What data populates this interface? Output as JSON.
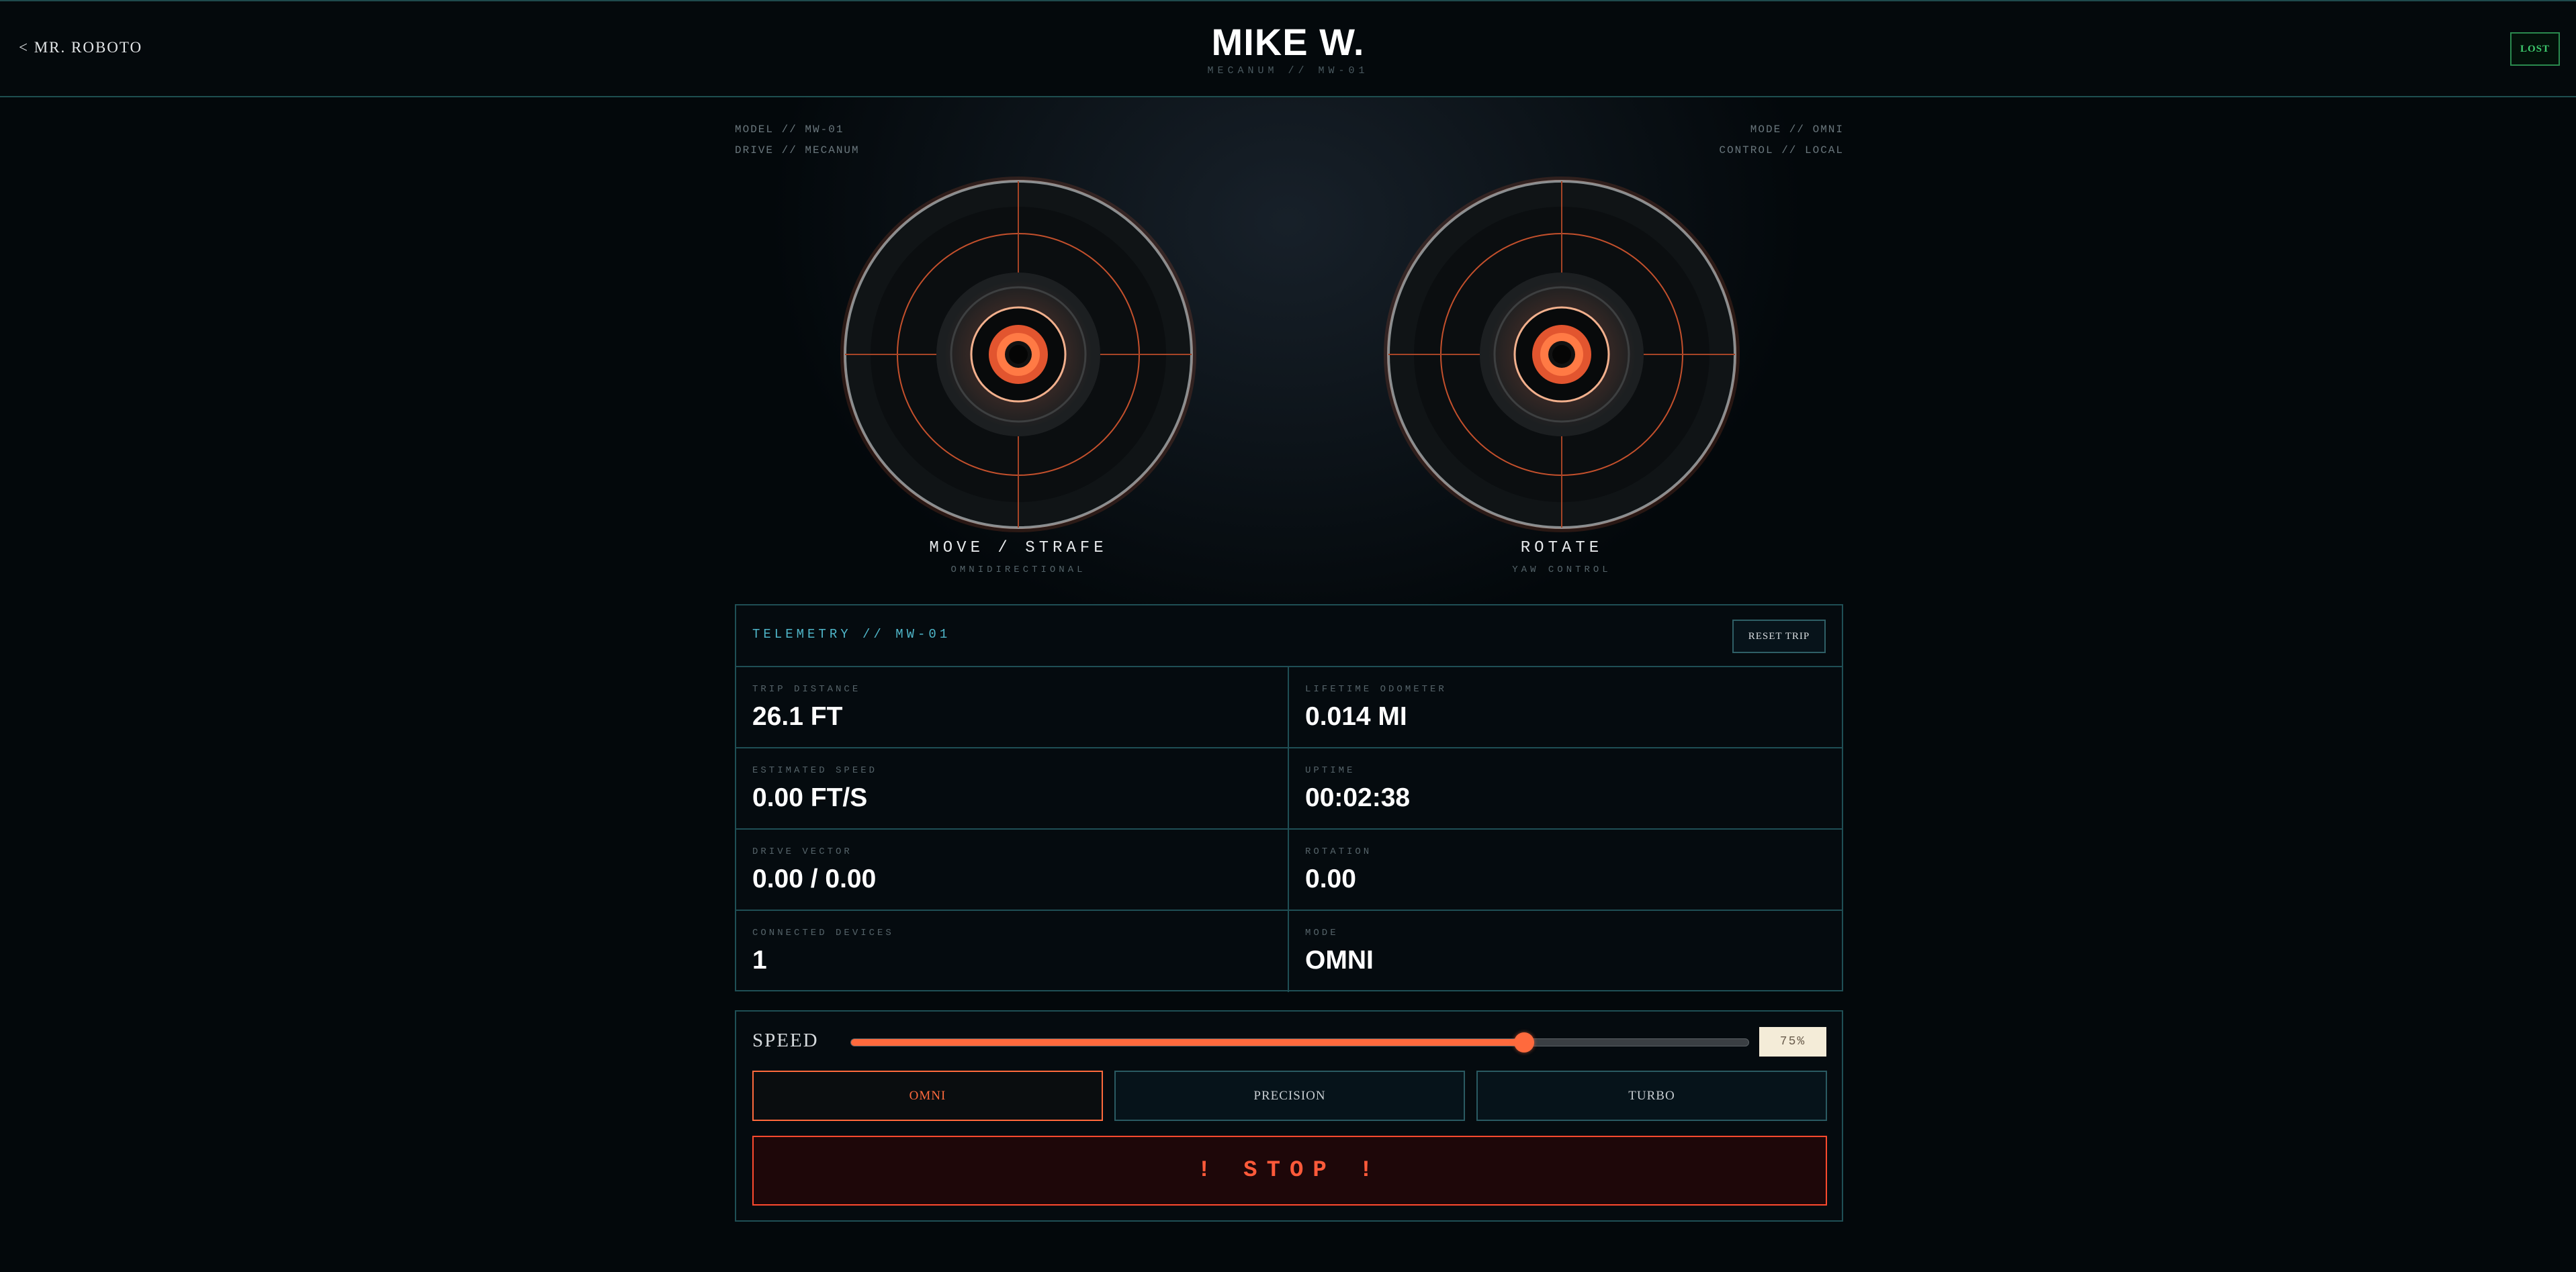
{
  "header": {
    "back_label": "< MR. ROBOTO",
    "title": "MIKE W.",
    "subtitle": "MECANUM // MW-01",
    "status": "LOST"
  },
  "meta": {
    "left": [
      "MODEL // MW-01",
      "DRIVE // MECANUM"
    ],
    "right": [
      "MODE // OMNI",
      "CONTROL // LOCAL"
    ]
  },
  "joysticks": [
    {
      "label": "MOVE / STRAFE",
      "sub": "OMNIDIRECTIONAL"
    },
    {
      "label": "ROTATE",
      "sub": "YAW CONTROL"
    }
  ],
  "telemetry": {
    "title": "TELEMETRY // MW-01",
    "reset_label": "RESET TRIP",
    "cells": [
      {
        "label": "TRIP DISTANCE",
        "value": "26.1 FT"
      },
      {
        "label": "LIFETIME ODOMETER",
        "value": "0.014 MI"
      },
      {
        "label": "ESTIMATED SPEED",
        "value": "0.00 FT/S"
      },
      {
        "label": "UPTIME",
        "value": "00:02:38"
      },
      {
        "label": "DRIVE VECTOR",
        "value": "0.00 / 0.00"
      },
      {
        "label": "ROTATION",
        "value": "0.00"
      },
      {
        "label": "CONNECTED DEVICES",
        "value": "1"
      },
      {
        "label": "MODE",
        "value": "OMNI"
      }
    ]
  },
  "controls": {
    "speed_label": "SPEED",
    "speed_percent": 75,
    "speed_text": "75%",
    "modes": [
      "OMNI",
      "PRECISION",
      "TURBO"
    ],
    "active_mode": "OMNI",
    "stop_label": "! STOP !"
  },
  "colors": {
    "accent": "#ff6a3d",
    "cyan": "#4fb6c9",
    "status_green": "#3ecb6e",
    "stop_red": "#ff4a2e"
  }
}
